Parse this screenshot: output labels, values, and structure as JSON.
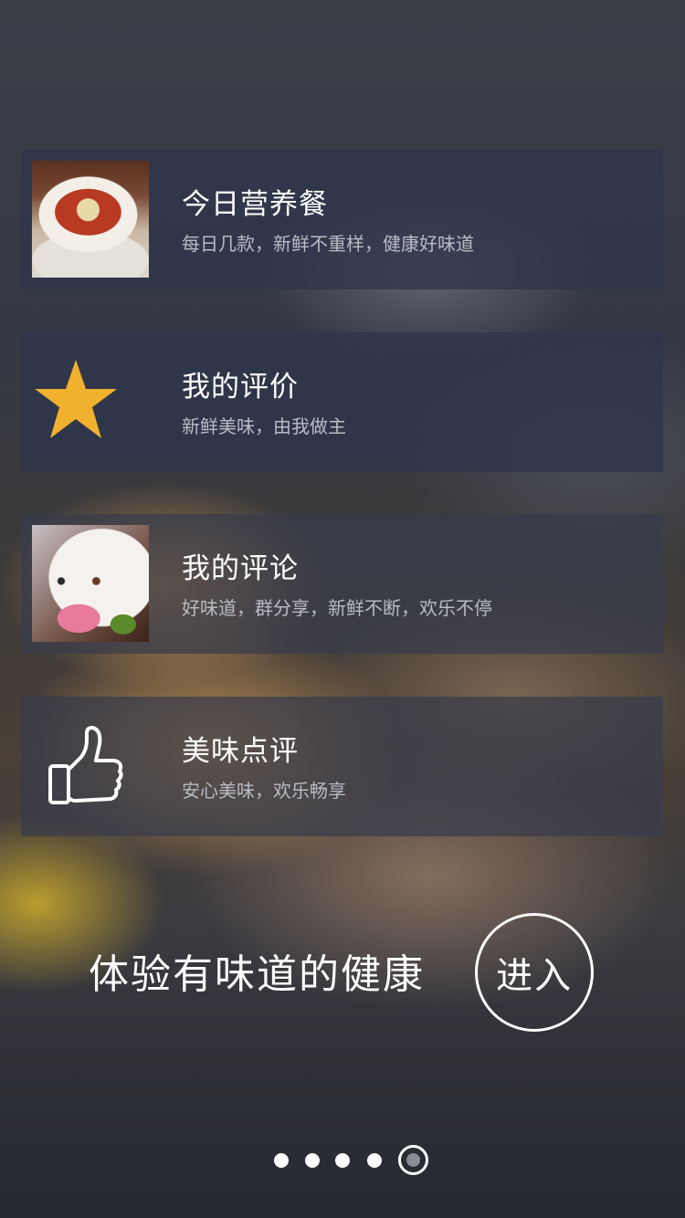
{
  "cards": [
    {
      "title": "今日营养餐",
      "subtitle": "每日几款，新鲜不重样，健康好味道",
      "image": "soup-photo"
    },
    {
      "title": "我的评价",
      "subtitle": "新鲜美味，由我做主",
      "icon": "star-icon"
    },
    {
      "title": "我的评论",
      "subtitle": "好味道，群分享，新鲜不断，欢乐不停",
      "image": "cat-photo"
    },
    {
      "title": "美味点评",
      "subtitle": "安心美味，欢乐畅享",
      "icon": "thumbs-up-icon"
    }
  ],
  "slogan": "体验有味道的健康",
  "enter_label": "进入",
  "pager": {
    "count": 5,
    "active_index": 5
  },
  "colors": {
    "star": "#f0b12e",
    "card_bg": "#2e364c",
    "text_primary": "#ffffff",
    "text_secondary": "#b9bcc4"
  }
}
